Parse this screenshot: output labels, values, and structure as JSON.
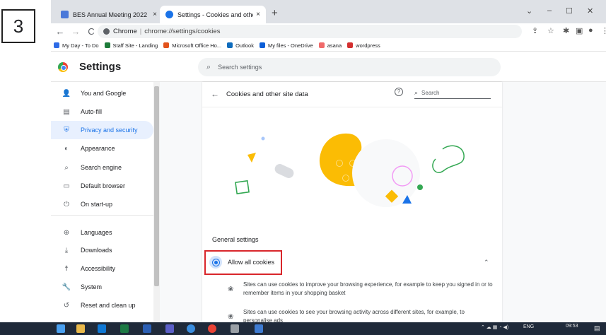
{
  "step_number": "3",
  "tabs": [
    {
      "title": "BES Annual Meeting 2022",
      "close": "×",
      "favicon_color": "#4a78d9"
    },
    {
      "title": "Settings - Cookies and other site",
      "close": "×",
      "favicon_color": "#5f6368"
    }
  ],
  "new_tab": "+",
  "window_controls": {
    "minimize": "–",
    "maximize": "☐",
    "close": "✕",
    "dropdown": "⌄"
  },
  "nav": {
    "back": "←",
    "forward": "→",
    "reload": "C"
  },
  "omnibox": {
    "site_label": "Chrome",
    "separator": "|",
    "url": "chrome://settings/cookies"
  },
  "bookmarks": [
    {
      "label": "My Day - To Do",
      "color": "#2e6be6"
    },
    {
      "label": "Staff Site - Landing",
      "color": "#1e7b3a"
    },
    {
      "label": "Microsoft Office Ho...",
      "color": "#e2531c"
    },
    {
      "label": "Outlook",
      "color": "#0f6cbd"
    },
    {
      "label": "My files - OneDrive",
      "color": "#0b5ed7"
    },
    {
      "label": "asana",
      "color": "#f06a6a"
    },
    {
      "label": "wordpress",
      "color": "#d32f2f"
    }
  ],
  "settings": {
    "title": "Settings",
    "search_placeholder": "Search settings"
  },
  "sidebar": {
    "items": [
      {
        "label": "You and Google",
        "icon": "👤"
      },
      {
        "label": "Auto-fill",
        "icon": "▤"
      },
      {
        "label": "Privacy and security",
        "icon": "⛨"
      },
      {
        "label": "Appearance",
        "icon": "◐"
      },
      {
        "label": "Search engine",
        "icon": "⌕"
      },
      {
        "label": "Default browser",
        "icon": "▭"
      },
      {
        "label": "On start-up",
        "icon": "⏻"
      },
      {
        "label": "Languages",
        "icon": "⊕"
      },
      {
        "label": "Downloads",
        "icon": "⤓"
      },
      {
        "label": "Accessibility",
        "icon": "☨"
      },
      {
        "label": "System",
        "icon": "🔧"
      },
      {
        "label": "Reset and clean up",
        "icon": "↺"
      }
    ]
  },
  "card": {
    "back": "←",
    "title": "Cookies and other site data",
    "help": "?",
    "search_placeholder": "Search",
    "general_settings": "General settings",
    "allow_all": "Allow all cookies",
    "chevron": "⌃",
    "desc1": "Sites can use cookies to improve your browsing experience, for example to keep you signed in or to remember items in your shopping basket",
    "desc2": "Sites can use cookies to see your browsing activity across different sites, for example, to personalise ads"
  },
  "taskbar": {
    "tray_lang": "ENG",
    "time": "09:53"
  },
  "colors": {
    "accent": "#1a73e8",
    "highlight_border": "#d9262b",
    "taskbar": "#1f2a3a"
  }
}
